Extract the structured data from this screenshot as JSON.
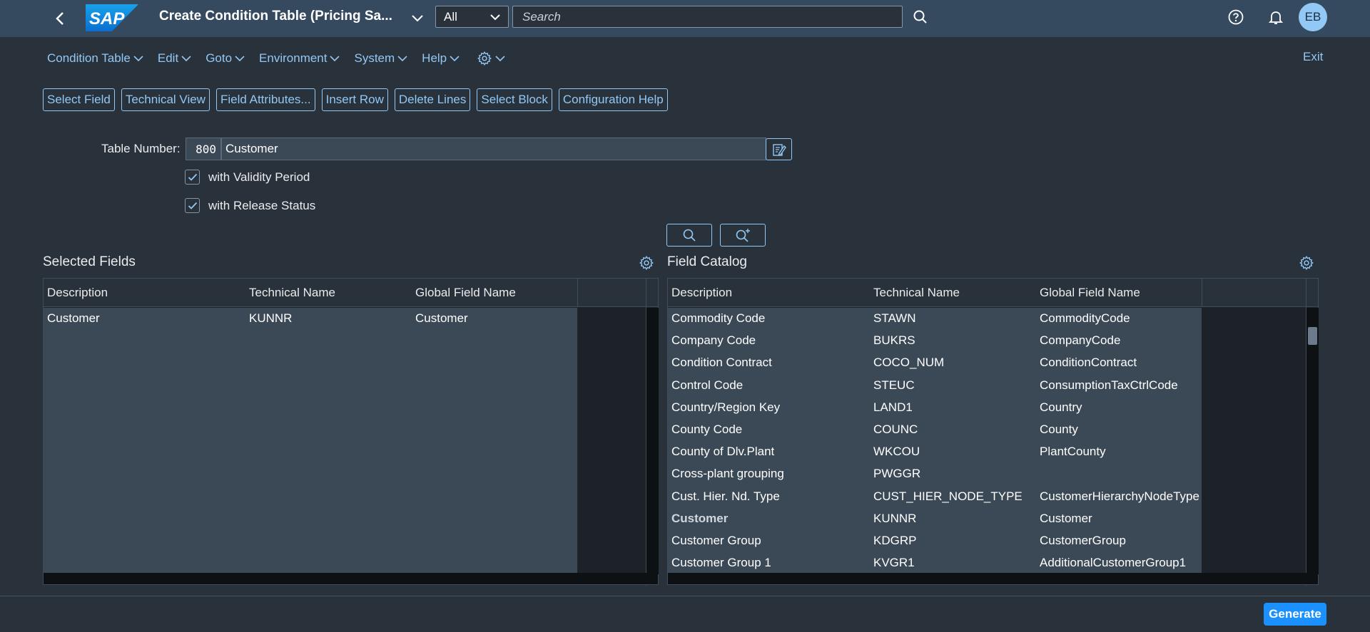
{
  "shell": {
    "title": "Create Condition Table (Pricing Sa...",
    "scope": "All",
    "search_placeholder": "Search",
    "avatar_initials": "EB",
    "logo_text": "SAP"
  },
  "menu": {
    "items": [
      "Condition Table",
      "Edit",
      "Goto",
      "Environment",
      "System",
      "Help"
    ],
    "exit": "Exit"
  },
  "toolbar": {
    "buttons": [
      "Select Field",
      "Technical View",
      "Field Attributes...",
      "Insert Row",
      "Delete Lines",
      "Select Block",
      "Configuration Help"
    ]
  },
  "form": {
    "table_number_label": "Table Number:",
    "table_number": "800",
    "table_name": "Customer",
    "validity_label": "with Validity Period",
    "release_label": "with Release Status",
    "validity_checked": true,
    "release_checked": true
  },
  "selected_fields": {
    "title": "Selected Fields",
    "columns": [
      "Description",
      "Technical Name",
      "Global Field Name"
    ],
    "rows": [
      {
        "desc": "Customer",
        "tech": "KUNNR",
        "global": "Customer"
      }
    ]
  },
  "field_catalog": {
    "title": "Field Catalog",
    "columns": [
      "Description",
      "Technical Name",
      "Global Field Name"
    ],
    "rows": [
      {
        "desc": "Commodity Code",
        "tech": "STAWN",
        "global": "CommodityCode"
      },
      {
        "desc": "Company Code",
        "tech": "BUKRS",
        "global": "CompanyCode"
      },
      {
        "desc": "Condition Contract",
        "tech": "COCO_NUM",
        "global": "ConditionContract"
      },
      {
        "desc": "Control Code",
        "tech": "STEUC",
        "global": "ConsumptionTaxCtrlCode"
      },
      {
        "desc": "Country/Region Key",
        "tech": "LAND1",
        "global": "Country"
      },
      {
        "desc": "County Code",
        "tech": "COUNC",
        "global": "County"
      },
      {
        "desc": "County of Dlv.Plant",
        "tech": "WKCOU",
        "global": "PlantCounty"
      },
      {
        "desc": "Cross-plant grouping",
        "tech": "PWGGR",
        "global": ""
      },
      {
        "desc": "Cust. Hier. Nd. Type",
        "tech": "CUST_HIER_NODE_TYPE",
        "global": "CustomerHierarchyNodeType"
      },
      {
        "desc": "Customer",
        "tech": "KUNNR",
        "global": "Customer",
        "bold": true
      },
      {
        "desc": "Customer Group",
        "tech": "KDGRP",
        "global": "CustomerGroup"
      },
      {
        "desc": "Customer Group 1",
        "tech": "KVGR1",
        "global": "AdditionalCustomerGroup1"
      }
    ]
  },
  "footer": {
    "generate_label": "Generate"
  },
  "colors": {
    "shell": "#354a5f",
    "background": "#29313a",
    "accent": "#91c8f6",
    "primary_button": "#1b90ff"
  }
}
